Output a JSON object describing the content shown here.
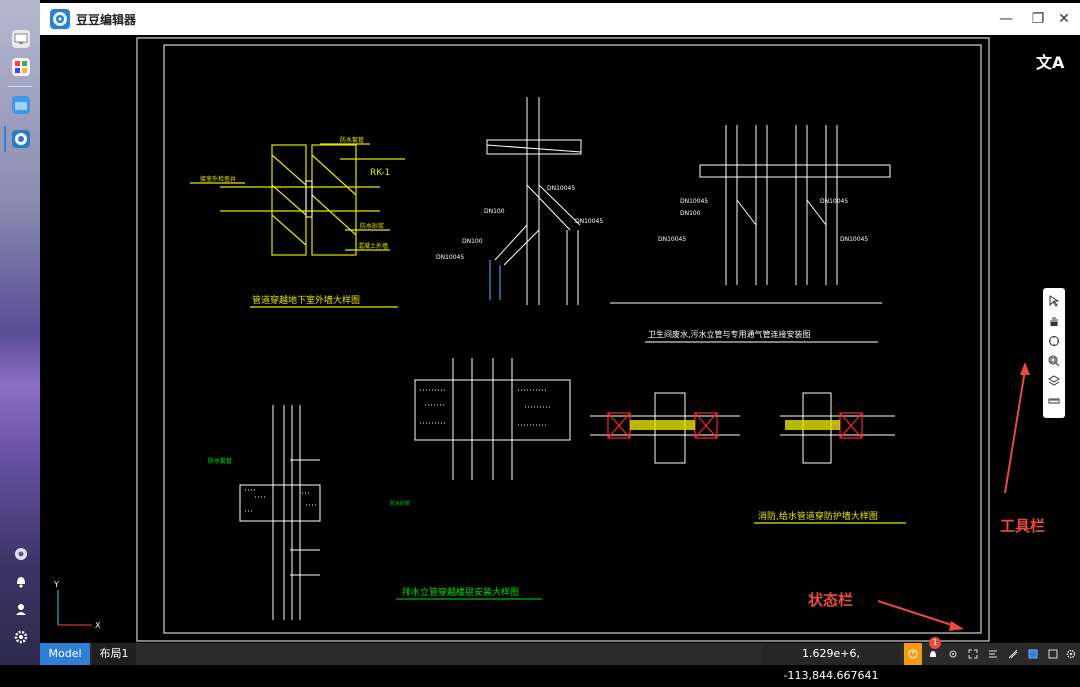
{
  "app": {
    "title": "豆豆编辑器"
  },
  "window_controls": {
    "minimize": "—",
    "maximize": "❐",
    "close": "✕"
  },
  "canvas": {
    "translate_icon": "文A",
    "drawings": {
      "d1_title": "管道穿越地下室外墙大样图",
      "d1_labels": [
        "防水套管",
        "RK-1",
        "防水砂浆",
        "混凝土外墙",
        "接室外检查井"
      ],
      "d2_labels": [
        "DN100",
        "DN10045"
      ],
      "d4_title": "卫生间废水,污水立管与专用通气管连接安装图",
      "d6_title": "排水立管穿越楼层安装大样图",
      "d8_title": "消防,给水管道穿防护墙大样图",
      "axis_y": "Y",
      "axis_x": "X"
    }
  },
  "toolbar": {
    "items": [
      "select-icon",
      "pan-hand-icon",
      "zoom-extents-icon",
      "zoom-window-icon",
      "layers-icon",
      "measure-icon"
    ]
  },
  "annotations": {
    "toolbar_label": "工具栏",
    "statusbar_label": "状态栏"
  },
  "statusbar": {
    "tabs": [
      {
        "label": "Model",
        "active": true
      },
      {
        "label": "布局1",
        "active": false
      }
    ],
    "coordinates": "1.629e+6, -113,844.667641",
    "notification_count": "1"
  },
  "colors": {
    "accent": "#2f7fd6",
    "cad_yellow": "#e6e600",
    "cad_green": "#00e000",
    "annotation_red": "#e94b3c"
  }
}
